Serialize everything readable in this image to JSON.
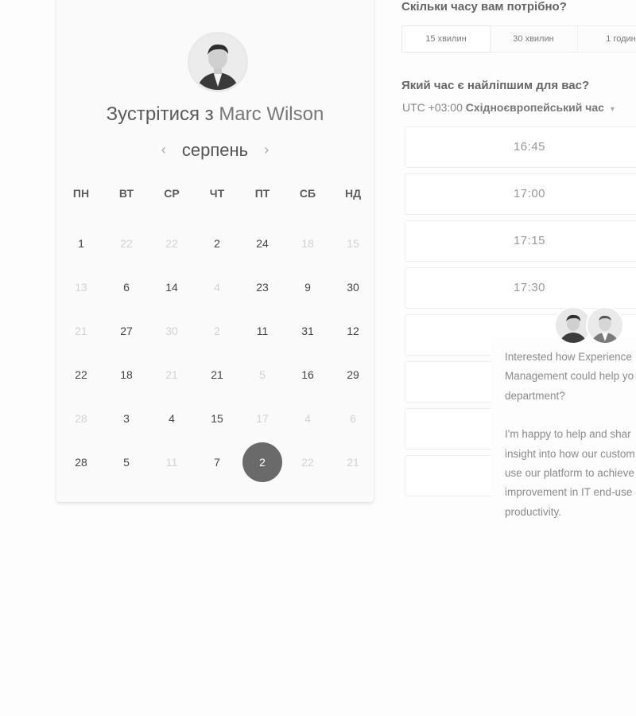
{
  "booking": {
    "meet_prefix": "Зустрітися з",
    "host_name": "Marc Wilson",
    "month": "серпень",
    "prev_arrow": "‹",
    "next_arrow": "›",
    "weekdays": [
      "ПН",
      "ВТ",
      "СР",
      "ЧТ",
      "ПТ",
      "СБ",
      "НД"
    ],
    "weeks": [
      [
        {
          "n": "1",
          "s": "active"
        },
        {
          "n": "22",
          "s": "muted"
        },
        {
          "n": "22",
          "s": "muted"
        },
        {
          "n": "2",
          "s": "active"
        },
        {
          "n": "24",
          "s": "active"
        },
        {
          "n": "18",
          "s": "muted"
        },
        {
          "n": "15",
          "s": "muted"
        }
      ],
      [
        {
          "n": "13",
          "s": "muted"
        },
        {
          "n": "6",
          "s": "active"
        },
        {
          "n": "14",
          "s": "active"
        },
        {
          "n": "4",
          "s": "muted"
        },
        {
          "n": "23",
          "s": "active"
        },
        {
          "n": "9",
          "s": "active"
        },
        {
          "n": "30",
          "s": "active"
        }
      ],
      [
        {
          "n": "21",
          "s": "muted"
        },
        {
          "n": "27",
          "s": "active"
        },
        {
          "n": "30",
          "s": "muted"
        },
        {
          "n": "2",
          "s": "muted"
        },
        {
          "n": "11",
          "s": "active"
        },
        {
          "n": "31",
          "s": "active"
        },
        {
          "n": "12",
          "s": "active"
        }
      ],
      [
        {
          "n": "22",
          "s": "active"
        },
        {
          "n": "18",
          "s": "active"
        },
        {
          "n": "21",
          "s": "muted"
        },
        {
          "n": "21",
          "s": "active"
        },
        {
          "n": "5",
          "s": "muted"
        },
        {
          "n": "16",
          "s": "active"
        },
        {
          "n": "29",
          "s": "active"
        }
      ],
      [
        {
          "n": "28",
          "s": "muted"
        },
        {
          "n": "3",
          "s": "active"
        },
        {
          "n": "4",
          "s": "active"
        },
        {
          "n": "15",
          "s": "active"
        },
        {
          "n": "17",
          "s": "muted"
        },
        {
          "n": "4",
          "s": "muted"
        },
        {
          "n": "6",
          "s": "muted"
        }
      ],
      [
        {
          "n": "28",
          "s": "active"
        },
        {
          "n": "5",
          "s": "active"
        },
        {
          "n": "11",
          "s": "muted"
        },
        {
          "n": "7",
          "s": "active"
        },
        {
          "n": "2",
          "s": "selected"
        },
        {
          "n": "22",
          "s": "muted"
        },
        {
          "n": "21",
          "s": "muted"
        }
      ]
    ]
  },
  "duration": {
    "question": "Скільки часу вам потрібно?",
    "options": [
      "15 хвилин",
      "30 хвилин",
      "1 годин"
    ]
  },
  "time": {
    "question": "Який час є найліпшим для вас?",
    "tz_offset": "UTC +03:00",
    "tz_name": "Східноєвропейський час",
    "tz_caret": "▾",
    "slots": [
      "16:45",
      "17:00",
      "17:15",
      "17:30",
      "",
      "",
      "",
      ""
    ]
  },
  "chat": {
    "lines_1": [
      "Interested how Experience",
      "Management could help yo",
      "department?"
    ],
    "lines_2": [
      "I'm happy to help and shar",
      "insight into how our custom",
      "use our platform to achieve",
      "improvement in IT end-use",
      "productivity."
    ]
  },
  "colors": {
    "selected_day": "#6a6a6a",
    "muted_day": "#d2d2d2"
  }
}
